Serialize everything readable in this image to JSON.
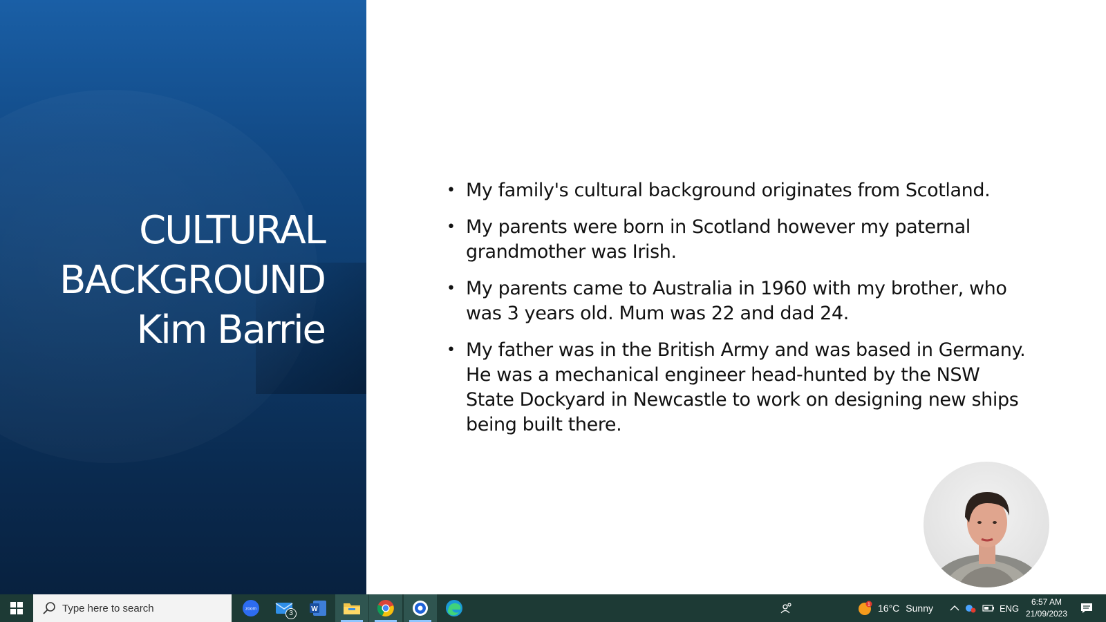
{
  "slide": {
    "title_lines": [
      "CULTURAL",
      "BACKGROUND",
      "Kim Barrie"
    ],
    "bullets": [
      "My family's cultural background originates from Scotland.",
      "My parents were born in Scotland however my paternal grandmother was Irish.",
      "My parents came to Australia in 1960 with my brother, who was 3 years old. Mum was 22 and dad 24.",
      "My father was in the British Army and was based in Germany. He was a mechanical engineer head-hunted by the NSW State Dockyard in Newcastle to work on designing new ships being built there."
    ],
    "bullet_symbol": "•"
  },
  "taskbar": {
    "search_placeholder": "Type here to search",
    "apps": [
      {
        "name": "zoom-icon",
        "label": "zoom"
      },
      {
        "name": "mail-icon",
        "badge": "3"
      },
      {
        "name": "word-icon",
        "label": "W"
      },
      {
        "name": "file-explorer-icon"
      },
      {
        "name": "chrome-icon"
      },
      {
        "name": "screen-recorder-icon"
      },
      {
        "name": "edge-icon"
      }
    ],
    "weather": {
      "temp": "16°C",
      "condition": "Sunny",
      "alert": "1"
    },
    "language": "ENG",
    "time": "6:57 AM",
    "date": "21/09/2023"
  },
  "colors": {
    "panel_top": "#1a5fa6",
    "panel_bottom": "#08213f",
    "taskbar": "#1d3a35"
  }
}
